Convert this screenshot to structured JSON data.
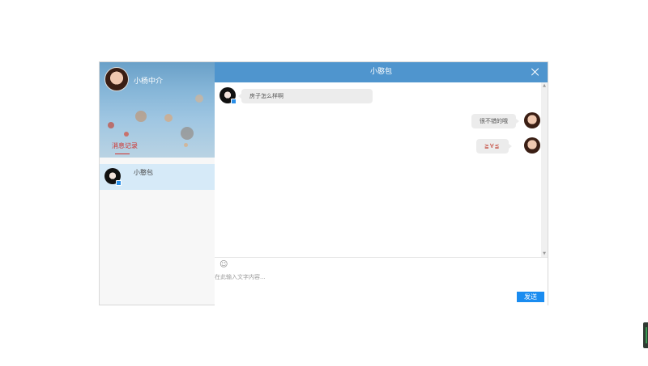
{
  "profile": {
    "name": "小杨中介",
    "tab_label": "消息记录"
  },
  "contacts": [
    {
      "name": "小憨包",
      "selected": true
    }
  ],
  "chat": {
    "title": "小憨包",
    "messages": [
      {
        "side": "left",
        "text": "房子怎么样啊"
      },
      {
        "side": "right",
        "text": "很不错的哦"
      },
      {
        "side": "right",
        "text": "≧∀≦"
      }
    ]
  },
  "composer": {
    "placeholder": "在此输入文字内容...",
    "value": "",
    "send_label": "发送",
    "emoji_icon": "☺"
  },
  "icons": {
    "close": "close-icon",
    "emoji": "smiley-icon",
    "scroll_up": "▲",
    "scroll_down": "▼"
  },
  "colors": {
    "header": "#4f95ce",
    "send_button": "#1a8cf0",
    "tab_active": "#d0312d",
    "selected_contact": "#d6eaf8"
  }
}
